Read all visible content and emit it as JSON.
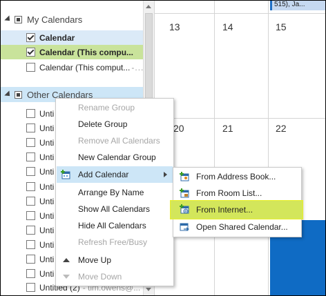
{
  "nav": {
    "my_calendars": {
      "label": "My Calendars",
      "items": [
        {
          "label": "Calendar",
          "checked": true,
          "bold": true,
          "selected": true
        },
        {
          "label": "Calendar (This compu...",
          "checked": true,
          "bold": true,
          "highlight": true
        },
        {
          "label": "Calendar (This comput...",
          "checked": false,
          "bold": false
        }
      ]
    },
    "other_calendars": {
      "label": "Other Calendars",
      "items": [
        {
          "label": "Unti"
        },
        {
          "label": "Unti"
        },
        {
          "label": "Unti"
        },
        {
          "label": "Unti"
        },
        {
          "label": "Unti"
        },
        {
          "label": "Unti"
        },
        {
          "label": "Unti"
        },
        {
          "label": "Unti"
        },
        {
          "label": "Unti"
        },
        {
          "label": "Unti"
        },
        {
          "label": "Unti"
        },
        {
          "label": "Unti"
        }
      ],
      "last_item": {
        "label": "Untitled (2)",
        "owner": "- tim.owens@..."
      }
    }
  },
  "calendar": {
    "days_row1": [
      "13",
      "14",
      "15"
    ],
    "days_row2": [
      "20",
      "21",
      "22"
    ],
    "appointment_top": "515), Ja..."
  },
  "context_menu": {
    "items": [
      {
        "label": "Rename Group",
        "disabled": true
      },
      {
        "label": "Delete Group",
        "disabled": false
      },
      {
        "label": "Remove All Calendars",
        "disabled": true
      },
      {
        "label": "New Calendar Group",
        "disabled": false
      },
      {
        "label": "Add Calendar",
        "disabled": false,
        "has_submenu": true,
        "hover": true
      },
      {
        "label": "Arrange By Name",
        "disabled": false
      },
      {
        "label": "Show All Calendars",
        "disabled": false
      },
      {
        "label": "Hide All Calendars",
        "disabled": false
      },
      {
        "label": "Refresh Free/Busy",
        "disabled": true
      },
      {
        "label": "Move Up",
        "disabled": false
      },
      {
        "label": "Move Down",
        "disabled": true
      }
    ]
  },
  "submenu": {
    "items": [
      {
        "label": "From Address Book..."
      },
      {
        "label": "From Room List..."
      },
      {
        "label": "From Internet...",
        "highlight": true
      },
      {
        "label": "Open Shared Calendar..."
      }
    ]
  },
  "colors": {
    "accent": "#0f6bc4",
    "highlight": "#d3e65b",
    "menu_hover": "#cde6f7",
    "selected_row": "#dbeaf7",
    "green_row": "#c9e39b"
  }
}
